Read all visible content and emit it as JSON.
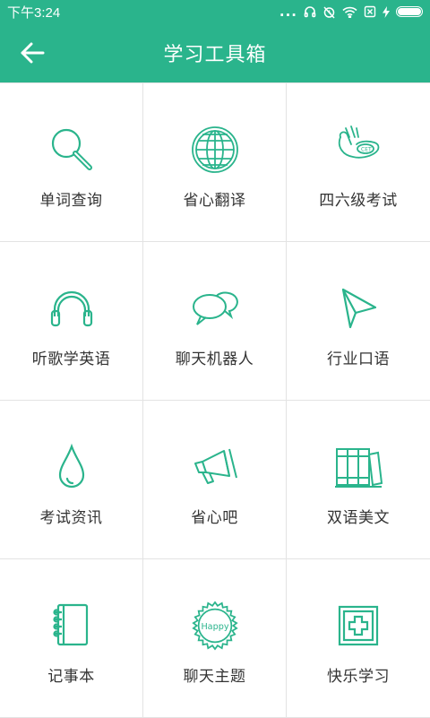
{
  "status_bar": {
    "time": "下午3:24",
    "dots": "..."
  },
  "header": {
    "title": "学习工具箱"
  },
  "tools": [
    {
      "label": "单词查询",
      "icon": "magnifier-icon"
    },
    {
      "label": "省心翻译",
      "icon": "globe-icon"
    },
    {
      "label": "四六级考试",
      "icon": "cet-ok-hand-icon"
    },
    {
      "label": "听歌学英语",
      "icon": "headphones-icon"
    },
    {
      "label": "聊天机器人",
      "icon": "chat-bubbles-icon"
    },
    {
      "label": "行业口语",
      "icon": "paper-plane-icon"
    },
    {
      "label": "考试资讯",
      "icon": "water-drop-icon"
    },
    {
      "label": "省心吧",
      "icon": "megaphone-icon"
    },
    {
      "label": "双语美文",
      "icon": "books-icon"
    },
    {
      "label": "记事本",
      "icon": "notebook-icon"
    },
    {
      "label": "聊天主题",
      "icon": "happy-badge-icon",
      "badge_text": "Happy"
    },
    {
      "label": "快乐学习",
      "icon": "plus-box-icon"
    }
  ],
  "colors": {
    "primary": "#2ab48c",
    "icon_stroke": "#2ab48c",
    "label": "#333333",
    "divider": "#e3e3e3"
  }
}
